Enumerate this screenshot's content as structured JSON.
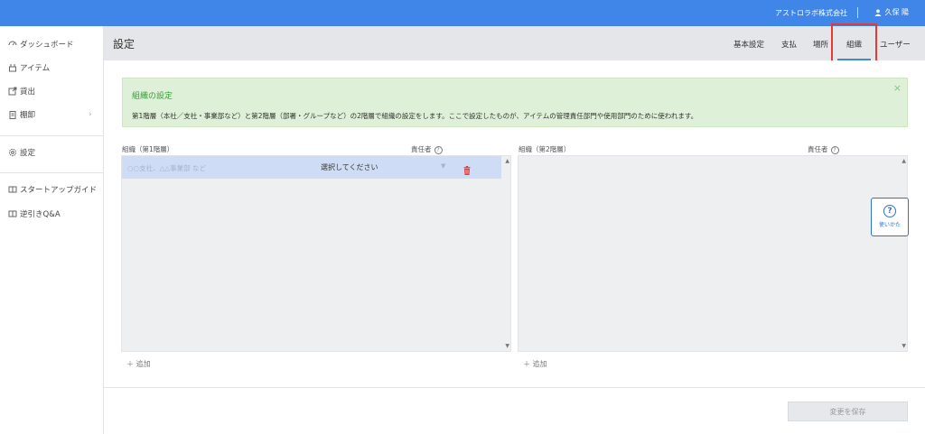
{
  "topbar": {
    "company": "アストロラボ株式会社",
    "user": "久保 陽"
  },
  "sidebar": {
    "items": [
      {
        "label": "ダッシュボード",
        "icon": "dashboard-icon"
      },
      {
        "label": "アイテム",
        "icon": "item-icon"
      },
      {
        "label": "貸出",
        "icon": "external-link-icon"
      },
      {
        "label": "棚卸",
        "icon": "clipboard-icon"
      },
      {
        "label": "設定",
        "icon": "gear-icon"
      },
      {
        "label": "スタートアップガイド",
        "icon": "book-icon"
      },
      {
        "label": "逆引きQ&A",
        "icon": "book-icon"
      }
    ],
    "arrow": "›"
  },
  "header": {
    "title": "設定",
    "tabs": [
      {
        "label": "基本設定"
      },
      {
        "label": "支払"
      },
      {
        "label": "場所"
      },
      {
        "label": "組織"
      },
      {
        "label": "ユーザー"
      }
    ],
    "active_tab": "組織"
  },
  "info": {
    "title": "組織の設定",
    "text": "第1階層（本社／支社・事業部など）と第2階層（部署・グループなど）の2階層で組織の設定をします。ここで設定したものが、アイテムの管理責任部門や使用部門のために使われます。",
    "close": "×"
  },
  "level1": {
    "label": "組織（第1階層）",
    "manager_label": "責任者",
    "help": "?",
    "input_placeholder": "○○支社、△△事業部 など",
    "select_value": "選択してください",
    "add_label": "＋ 追加"
  },
  "level2": {
    "label": "組織（第2階層）",
    "manager_label": "責任者",
    "help": "?",
    "add_label": "＋ 追加"
  },
  "help_button": {
    "icon": "?",
    "label": "使いかた"
  },
  "save_button": "変更を保存",
  "colors": {
    "topbar": "#3f86e8",
    "active_tab_underline": "#3f86e8",
    "highlight_box": "#e53935",
    "info_bg": "#dff0d8",
    "info_title": "#3c9a3c",
    "selected_row": "#cfdcf6",
    "trash": "#e53935"
  }
}
